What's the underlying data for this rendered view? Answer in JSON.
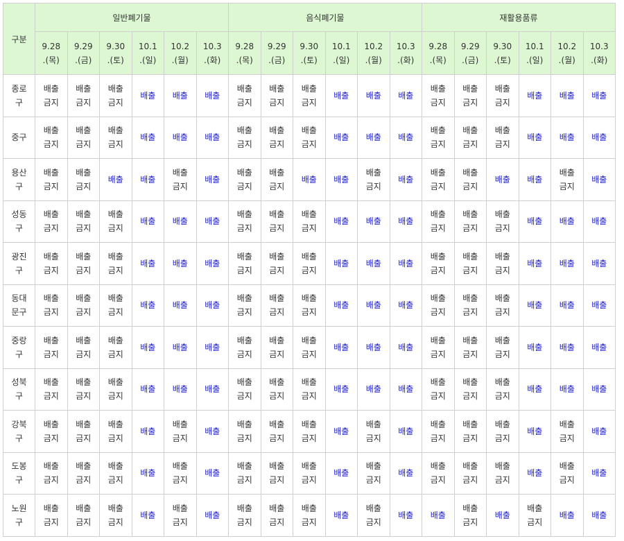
{
  "header": {
    "category_label": "구분",
    "groups": [
      "일반폐기물",
      "음식폐기물",
      "재활용품류"
    ],
    "dates": [
      {
        "day": "9.28",
        "weekday": ".(목)"
      },
      {
        "day": "9.29",
        "weekday": ".(금)"
      },
      {
        "day": "9.30",
        "weekday": ".(토)"
      },
      {
        "day": "10.1",
        "weekday": ".(일)"
      },
      {
        "day": "10.2",
        "weekday": ".(월)"
      },
      {
        "day": "10.3",
        "weekday": ".(화)"
      }
    ]
  },
  "labels": {
    "ban": "배출\n금지",
    "ok": "배출"
  },
  "colors": {
    "header_bg": "#dcf7d2",
    "ok_text": "#2020d0",
    "ban_text": "#333333",
    "border": "#cfcfcf"
  },
  "rows": [
    {
      "district": "종로\n구",
      "cells": [
        "ban",
        "ban",
        "ban",
        "ok",
        "ok",
        "ok",
        "ban",
        "ban",
        "ban",
        "ok",
        "ok",
        "ok",
        "ban",
        "ban",
        "ban",
        "ok",
        "ok",
        "ok"
      ]
    },
    {
      "district": "중구",
      "cells": [
        "ban",
        "ban",
        "ban",
        "ok",
        "ok",
        "ok",
        "ban",
        "ban",
        "ban",
        "ok",
        "ok",
        "ok",
        "ban",
        "ban",
        "ban",
        "ok",
        "ok",
        "ok"
      ]
    },
    {
      "district": "용산\n구",
      "cells": [
        "ban",
        "ban",
        "ok",
        "ok",
        "ban",
        "ok",
        "ban",
        "ban",
        "ok",
        "ok",
        "ban",
        "ok",
        "ban",
        "ban",
        "ok",
        "ok",
        "ban",
        "ok"
      ]
    },
    {
      "district": "성동\n구",
      "cells": [
        "ban",
        "ban",
        "ban",
        "ok",
        "ok",
        "ok",
        "ban",
        "ban",
        "ban",
        "ok",
        "ok",
        "ok",
        "ban",
        "ban",
        "ban",
        "ok",
        "ok",
        "ok"
      ]
    },
    {
      "district": "광진\n구",
      "cells": [
        "ban",
        "ban",
        "ban",
        "ok",
        "ok",
        "ok",
        "ban",
        "ban",
        "ban",
        "ok",
        "ok",
        "ok",
        "ban",
        "ban",
        "ban",
        "ok",
        "ok",
        "ok"
      ]
    },
    {
      "district": "동대\n문구",
      "cells": [
        "ban",
        "ban",
        "ban",
        "ok",
        "ok",
        "ok",
        "ban",
        "ban",
        "ban",
        "ok",
        "ok",
        "ok",
        "ban",
        "ban",
        "ban",
        "ok",
        "ok",
        "ok"
      ]
    },
    {
      "district": "중랑\n구",
      "cells": [
        "ban",
        "ban",
        "ban",
        "ok",
        "ok",
        "ok",
        "ban",
        "ban",
        "ban",
        "ok",
        "ok",
        "ok",
        "ban",
        "ban",
        "ban",
        "ok",
        "ok",
        "ok"
      ]
    },
    {
      "district": "성북\n구",
      "cells": [
        "ban",
        "ban",
        "ban",
        "ok",
        "ok",
        "ok",
        "ban",
        "ban",
        "ban",
        "ok",
        "ok",
        "ok",
        "ban",
        "ban",
        "ban",
        "ok",
        "ok",
        "ok"
      ]
    },
    {
      "district": "강북\n구",
      "cells": [
        "ban",
        "ban",
        "ban",
        "ok",
        "ban",
        "ok",
        "ban",
        "ban",
        "ban",
        "ok",
        "ban",
        "ok",
        "ban",
        "ban",
        "ban",
        "ok",
        "ban",
        "ok"
      ]
    },
    {
      "district": "도봉\n구",
      "cells": [
        "ban",
        "ban",
        "ban",
        "ok",
        "ban",
        "ok",
        "ban",
        "ban",
        "ban",
        "ok",
        "ban",
        "ok",
        "ban",
        "ban",
        "ban",
        "ok",
        "ban",
        "ok"
      ]
    },
    {
      "district": "노원\n구",
      "cells": [
        "ban",
        "ban",
        "ban",
        "ok",
        "ban",
        "ok",
        "ban",
        "ban",
        "ban",
        "ok",
        "ban",
        "ok",
        "ok",
        "ban",
        "ok",
        "ban",
        "ok",
        "ok"
      ]
    }
  ]
}
